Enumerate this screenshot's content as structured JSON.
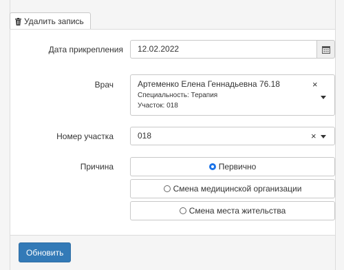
{
  "toolbar": {
    "delete_label": "Удалить запись"
  },
  "form": {
    "date": {
      "label": "Дата прикрепления",
      "value": "12.02.2022"
    },
    "doctor": {
      "label": "Врач",
      "name": "Артеменко Елена Геннадьевна 76.18",
      "specialty": "Специальность: Терапия",
      "area": "Участок: 018",
      "clear_glyph": "×"
    },
    "area_number": {
      "label": "Номер участка",
      "value": "018",
      "clear_glyph": "×"
    },
    "reason": {
      "label": "Причина",
      "options": [
        {
          "label": "Первично",
          "checked": true
        },
        {
          "label": "Смена медицинской организации",
          "checked": false
        },
        {
          "label": "Смена места жительства",
          "checked": false
        }
      ]
    }
  },
  "footer": {
    "update_label": "Обновить"
  },
  "colors": {
    "primary": "#337ab7",
    "radio_checked": "#1a73e8"
  }
}
